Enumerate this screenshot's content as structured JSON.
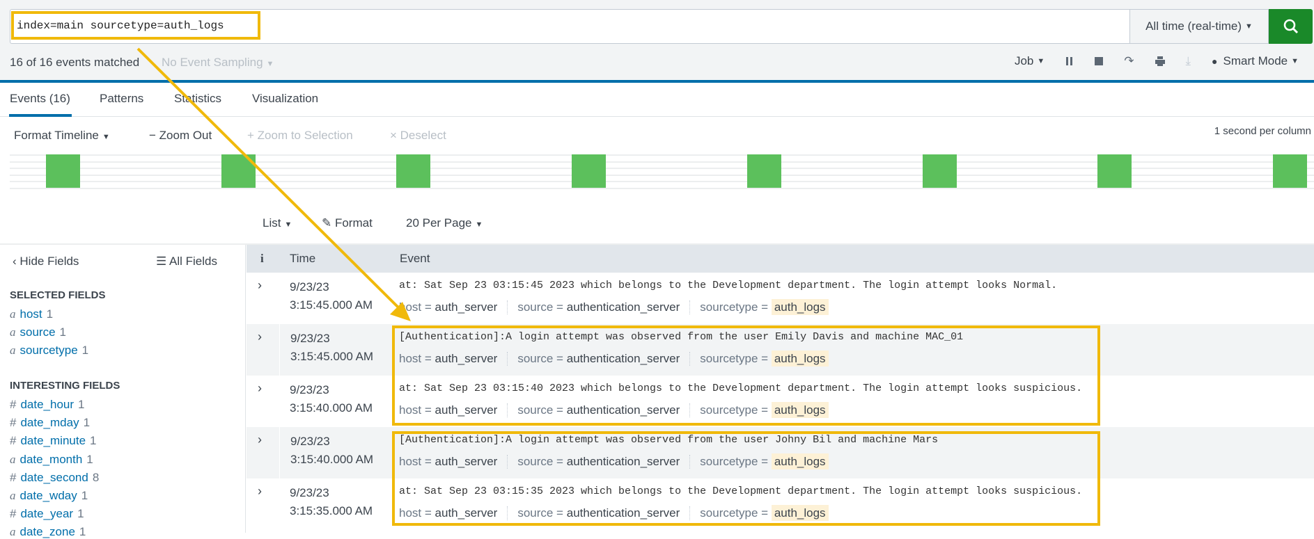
{
  "search": {
    "query": "index=main sourcetype=auth_logs",
    "time_range": "All time (real-time)"
  },
  "status": {
    "matched": "16 of 16 events matched",
    "sampling": "No Event Sampling"
  },
  "job": {
    "job_label": "Job",
    "mode_label": "Smart Mode"
  },
  "tabs": [
    {
      "label": "Events (16)"
    },
    {
      "label": "Patterns"
    },
    {
      "label": "Statistics"
    },
    {
      "label": "Visualization"
    }
  ],
  "timeline": {
    "format": "Format Timeline",
    "zoom_out": "Zoom Out",
    "zoom_sel": "Zoom to Selection",
    "deselect": "Deselect",
    "scale": "1 second per column",
    "bar_count": 8
  },
  "list_toolbar": {
    "list": "List",
    "format": "Format",
    "per_page": "20 Per Page"
  },
  "sidebar": {
    "hide": "Hide Fields",
    "all": "All Fields",
    "selected_heading": "SELECTED FIELDS",
    "interesting_heading": "INTERESTING FIELDS",
    "selected": [
      {
        "type": "a",
        "name": "host",
        "count": "1"
      },
      {
        "type": "a",
        "name": "source",
        "count": "1"
      },
      {
        "type": "a",
        "name": "sourcetype",
        "count": "1"
      }
    ],
    "interesting": [
      {
        "type": "#",
        "name": "date_hour",
        "count": "1"
      },
      {
        "type": "#",
        "name": "date_mday",
        "count": "1"
      },
      {
        "type": "#",
        "name": "date_minute",
        "count": "1"
      },
      {
        "type": "a",
        "name": "date_month",
        "count": "1"
      },
      {
        "type": "#",
        "name": "date_second",
        "count": "8"
      },
      {
        "type": "a",
        "name": "date_wday",
        "count": "1"
      },
      {
        "type": "#",
        "name": "date_year",
        "count": "1"
      },
      {
        "type": "a",
        "name": "date_zone",
        "count": "1"
      }
    ]
  },
  "table": {
    "headers": {
      "info": "i",
      "time": "Time",
      "event": "Event"
    },
    "rows": [
      {
        "date": "9/23/23",
        "time": "3:15:45.000 AM",
        "event": "at: Sat Sep 23 03:15:45 2023 which belongs to the Development department. The login attempt looks Normal.",
        "host": "auth_server",
        "source": "authentication_server",
        "sourcetype": "auth_logs"
      },
      {
        "date": "9/23/23",
        "time": "3:15:45.000 AM",
        "event": "[Authentication]:A login attempt was observed from the user Emily Davis and machine MAC_01",
        "host": "auth_server",
        "source": "authentication_server",
        "sourcetype": "auth_logs"
      },
      {
        "date": "9/23/23",
        "time": "3:15:40.000 AM",
        "event": "at: Sat Sep 23 03:15:40 2023 which belongs to the Development department. The login attempt looks suspicious.",
        "host": "auth_server",
        "source": "authentication_server",
        "sourcetype": "auth_logs"
      },
      {
        "date": "9/23/23",
        "time": "3:15:40.000 AM",
        "event": "[Authentication]:A login attempt was observed from the user Johny Bil and machine Mars",
        "host": "auth_server",
        "source": "authentication_server",
        "sourcetype": "auth_logs"
      },
      {
        "date": "9/23/23",
        "time": "3:15:35.000 AM",
        "event": "at: Sat Sep 23 03:15:35 2023 which belongs to the Development department. The login attempt looks suspicious.",
        "host": "auth_server",
        "source": "authentication_server",
        "sourcetype": "auth_logs"
      }
    ],
    "field_keys": {
      "host": "host =",
      "source": "source =",
      "sourcetype": "sourcetype ="
    }
  },
  "colors": {
    "accent": "#006eaa",
    "search_button": "#1a8929",
    "timeline_bar": "#5cc05c",
    "annotation": "#f0b90b"
  }
}
